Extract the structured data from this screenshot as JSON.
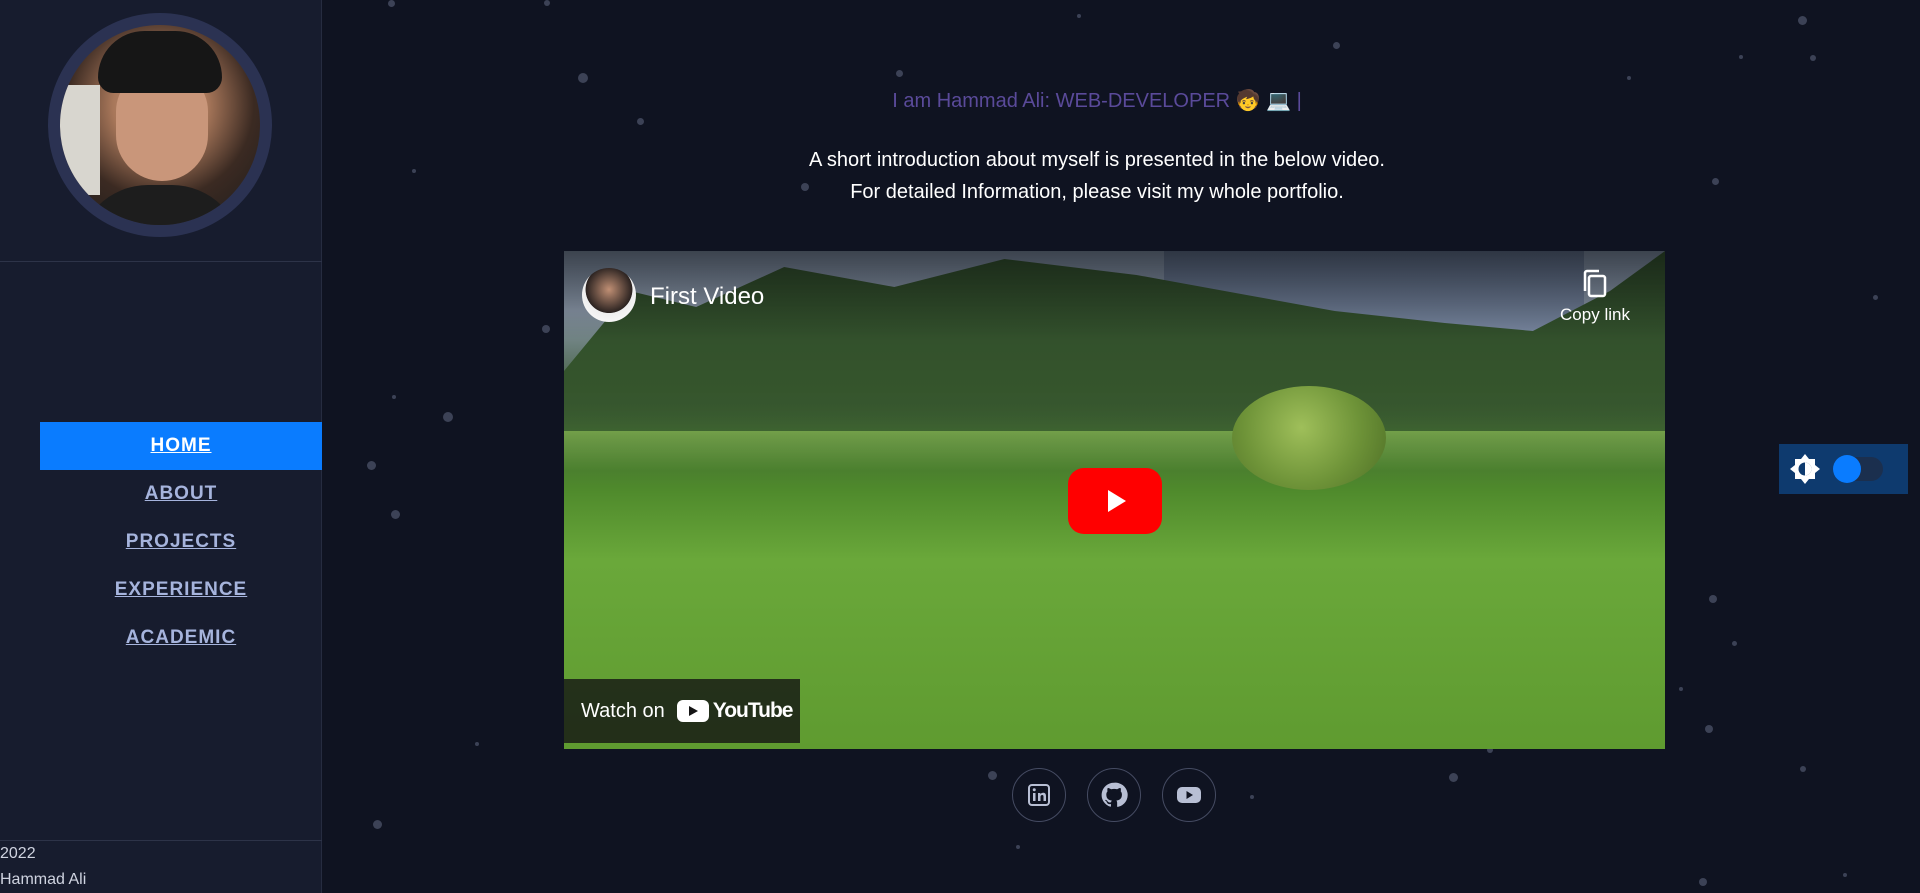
{
  "sidebar": {
    "nav": [
      {
        "label": "HOME",
        "active": true
      },
      {
        "label": "ABOUT",
        "active": false
      },
      {
        "label": "PROJECTS",
        "active": false
      },
      {
        "label": "EXPERIENCE",
        "active": false
      },
      {
        "label": "ACADEMIC",
        "active": false
      }
    ],
    "footer": {
      "year": "2022",
      "name": "Hammad Ali"
    }
  },
  "main": {
    "headline": "I am Hammad Ali: WEB-DEVELOPER 🧒 💻 |",
    "intro_line1": "A short introduction about myself is presented in the below video.",
    "intro_line2": "For detailed Information, please visit my whole portfolio."
  },
  "video": {
    "title": "First Video",
    "copy_link_label": "Copy link",
    "watch_on_label": "Watch on",
    "youtube_wordmark": "YouTube"
  },
  "socials": [
    {
      "icon": "linkedin-icon"
    },
    {
      "icon": "github-icon"
    },
    {
      "icon": "youtube-icon"
    }
  ],
  "theme_toggle": {
    "icon": "brightness-icon",
    "enabled": false
  },
  "colors": {
    "background": "#0f1321",
    "sidebar": "#171c2e",
    "accent": "#0a7cff",
    "headline": "#5a4a9a",
    "nav_text": "#a6b4dd",
    "youtube_red": "#ff0000"
  }
}
